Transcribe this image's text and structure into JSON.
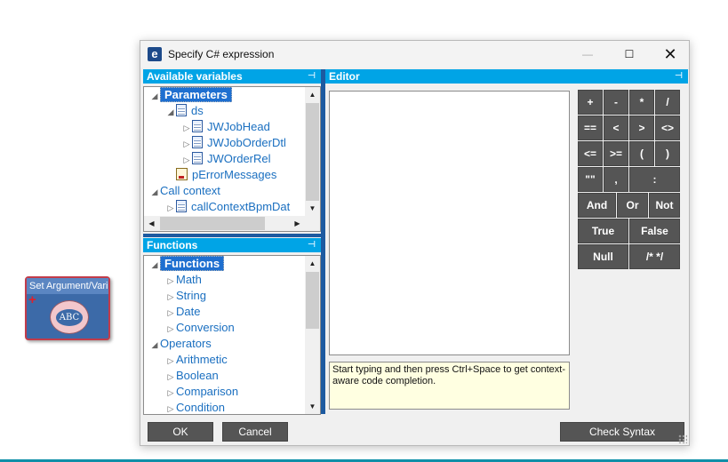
{
  "activity": {
    "title": "Set Argument/Vari",
    "badge": "ABC"
  },
  "window": {
    "icon_letter": "e",
    "title": "Specify C# expression",
    "controls": {
      "minimize": "—",
      "maximize": "☐",
      "close": "✕"
    }
  },
  "variables_panel": {
    "header": "Available variables",
    "pin": "⊣",
    "items": [
      {
        "label": "Parameters",
        "depth": 0,
        "expander": "◢",
        "icon": "none",
        "selected": true
      },
      {
        "label": "ds",
        "depth": 1,
        "expander": "◢",
        "icon": "dataset-icon",
        "selected": false
      },
      {
        "label": "JWJobHead",
        "depth": 2,
        "expander": "▷",
        "icon": "table-icon",
        "selected": false
      },
      {
        "label": "JWJobOrderDtl",
        "depth": 2,
        "expander": "▷",
        "icon": "table-icon",
        "selected": false
      },
      {
        "label": "JWOrderRel",
        "depth": 2,
        "expander": "▷",
        "icon": "table-icon",
        "selected": false
      },
      {
        "label": "pErrorMessages",
        "depth": 1,
        "expander": "",
        "icon": "message-icon",
        "selected": false
      },
      {
        "label": "Call context",
        "depth": 0,
        "expander": "◢",
        "icon": "none",
        "selected": false
      },
      {
        "label": "callContextBpmDat",
        "depth": 1,
        "expander": "▷",
        "icon": "dataset-icon",
        "selected": false
      }
    ]
  },
  "functions_panel": {
    "header": "Functions",
    "pin": "⊣",
    "items": [
      {
        "label": "Functions",
        "depth": 0,
        "expander": "◢",
        "selected": true
      },
      {
        "label": "Math",
        "depth": 1,
        "expander": "▷",
        "selected": false
      },
      {
        "label": "String",
        "depth": 1,
        "expander": "▷",
        "selected": false
      },
      {
        "label": "Date",
        "depth": 1,
        "expander": "▷",
        "selected": false
      },
      {
        "label": "Conversion",
        "depth": 1,
        "expander": "▷",
        "selected": false
      },
      {
        "label": "Operators",
        "depth": 0,
        "expander": "◢",
        "selected": false
      },
      {
        "label": "Arithmetic",
        "depth": 1,
        "expander": "▷",
        "selected": false
      },
      {
        "label": "Boolean",
        "depth": 1,
        "expander": "▷",
        "selected": false
      },
      {
        "label": "Comparison",
        "depth": 1,
        "expander": "▷",
        "selected": false
      },
      {
        "label": "Condition",
        "depth": 1,
        "expander": "▷",
        "selected": false
      }
    ]
  },
  "editor": {
    "header": "Editor",
    "pin": "⊣",
    "content": "",
    "hint": "Start typing and then press Ctrl+Space to get context-aware code completion."
  },
  "keypad": [
    [
      "+",
      "-",
      "*",
      "/"
    ],
    [
      "==",
      "<",
      ">",
      "<>"
    ],
    [
      "<=",
      ">=",
      "(",
      ")"
    ],
    [
      "\"\"",
      ",",
      ":"
    ],
    [
      "And",
      "Or",
      "Not"
    ],
    [
      "True",
      "False"
    ],
    [
      "Null",
      "/* */"
    ]
  ],
  "scroll": {
    "up": "▲",
    "down": "▼",
    "left": "◀",
    "right": "▶"
  },
  "footer": {
    "ok": "OK",
    "cancel": "Cancel",
    "check_syntax": "Check Syntax"
  }
}
